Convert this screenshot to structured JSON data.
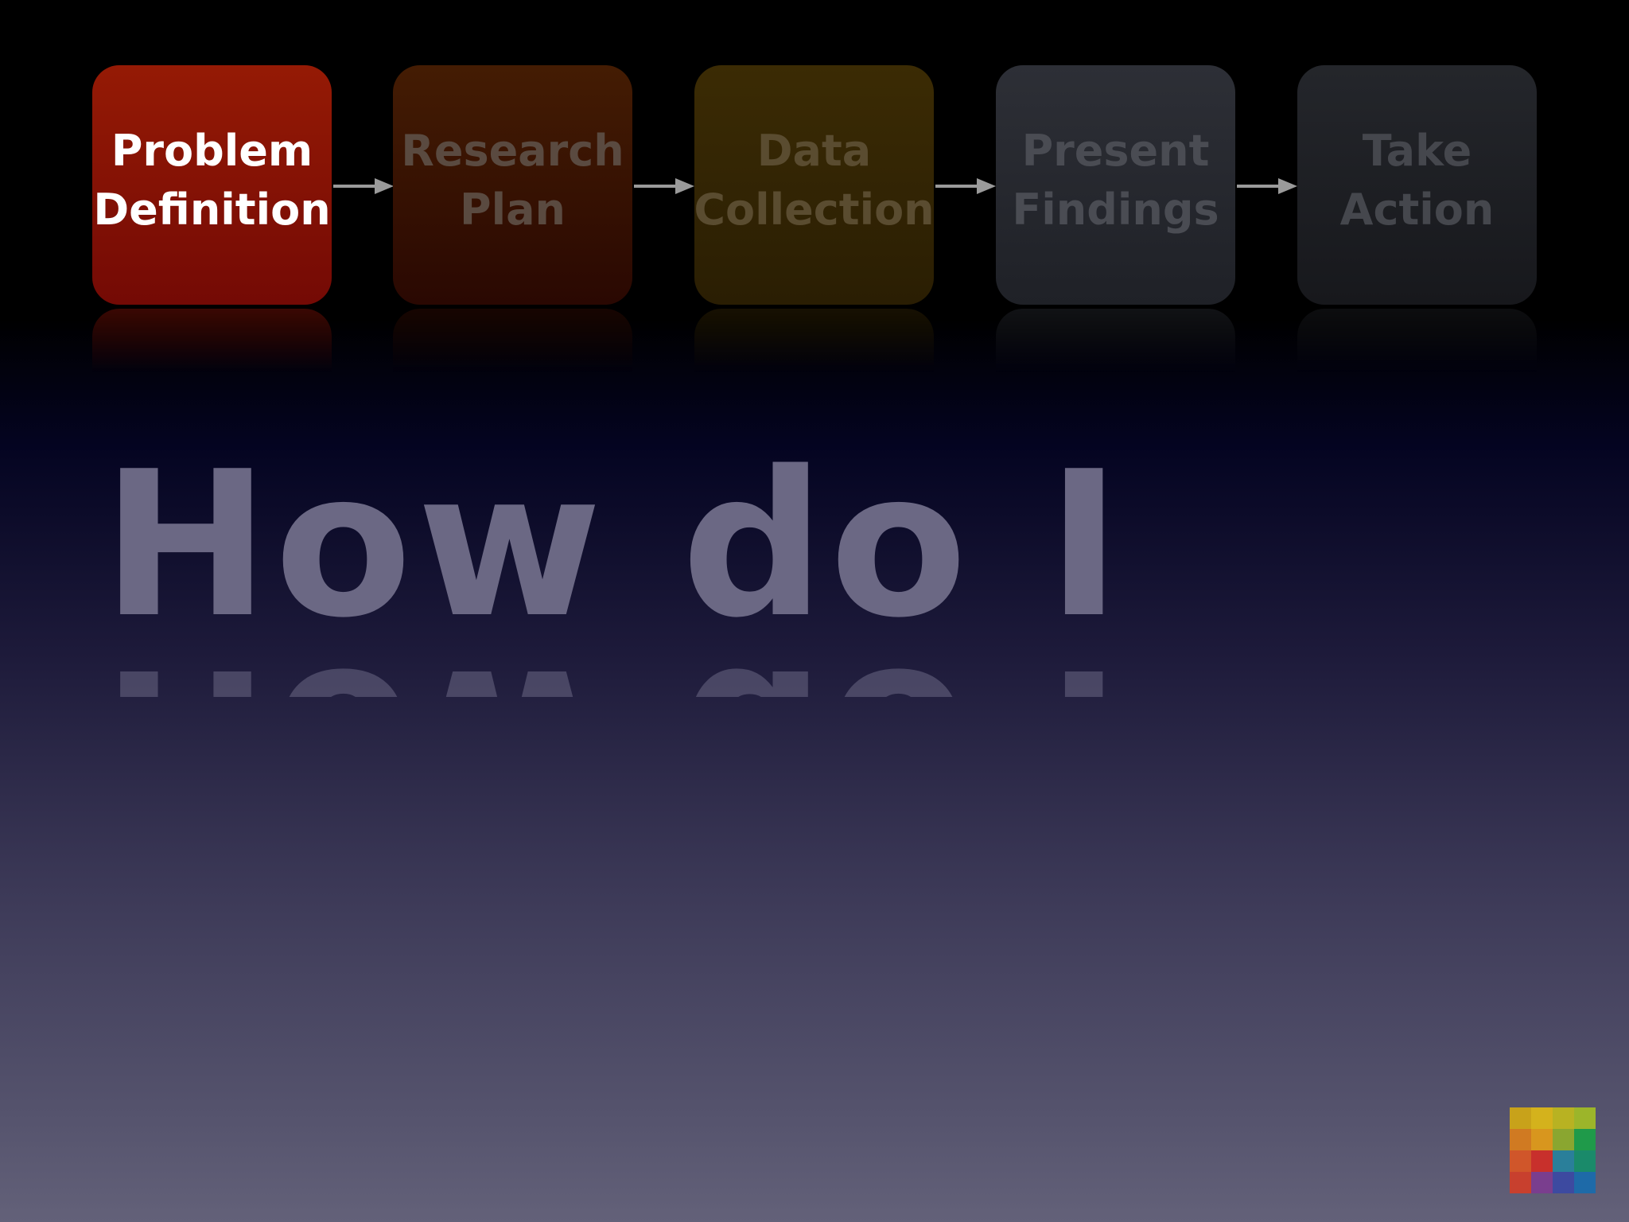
{
  "process_steps": [
    {
      "line1": "Problem",
      "line2": "Definition",
      "state": "active"
    },
    {
      "line1": "Research",
      "line2": "Plan",
      "state": "inactive"
    },
    {
      "line1": "Data",
      "line2": "Collection",
      "state": "inactive"
    },
    {
      "line1": "Present",
      "line2": "Findings",
      "state": "inactive"
    },
    {
      "line1": "Take",
      "line2": "Action",
      "state": "inactive"
    }
  ],
  "headline": "How do I",
  "colors": {
    "active_step": "#8a1405",
    "research_plan": "#3a1503",
    "data_collection": "#332603",
    "present_findings": "#26282e",
    "take_action": "#1e1f24",
    "arrow": "#9a9a9a",
    "headline_text": "#6b6884"
  },
  "icons": {
    "arrow": "right-arrow-icon",
    "logo": "color-grid-logo"
  }
}
